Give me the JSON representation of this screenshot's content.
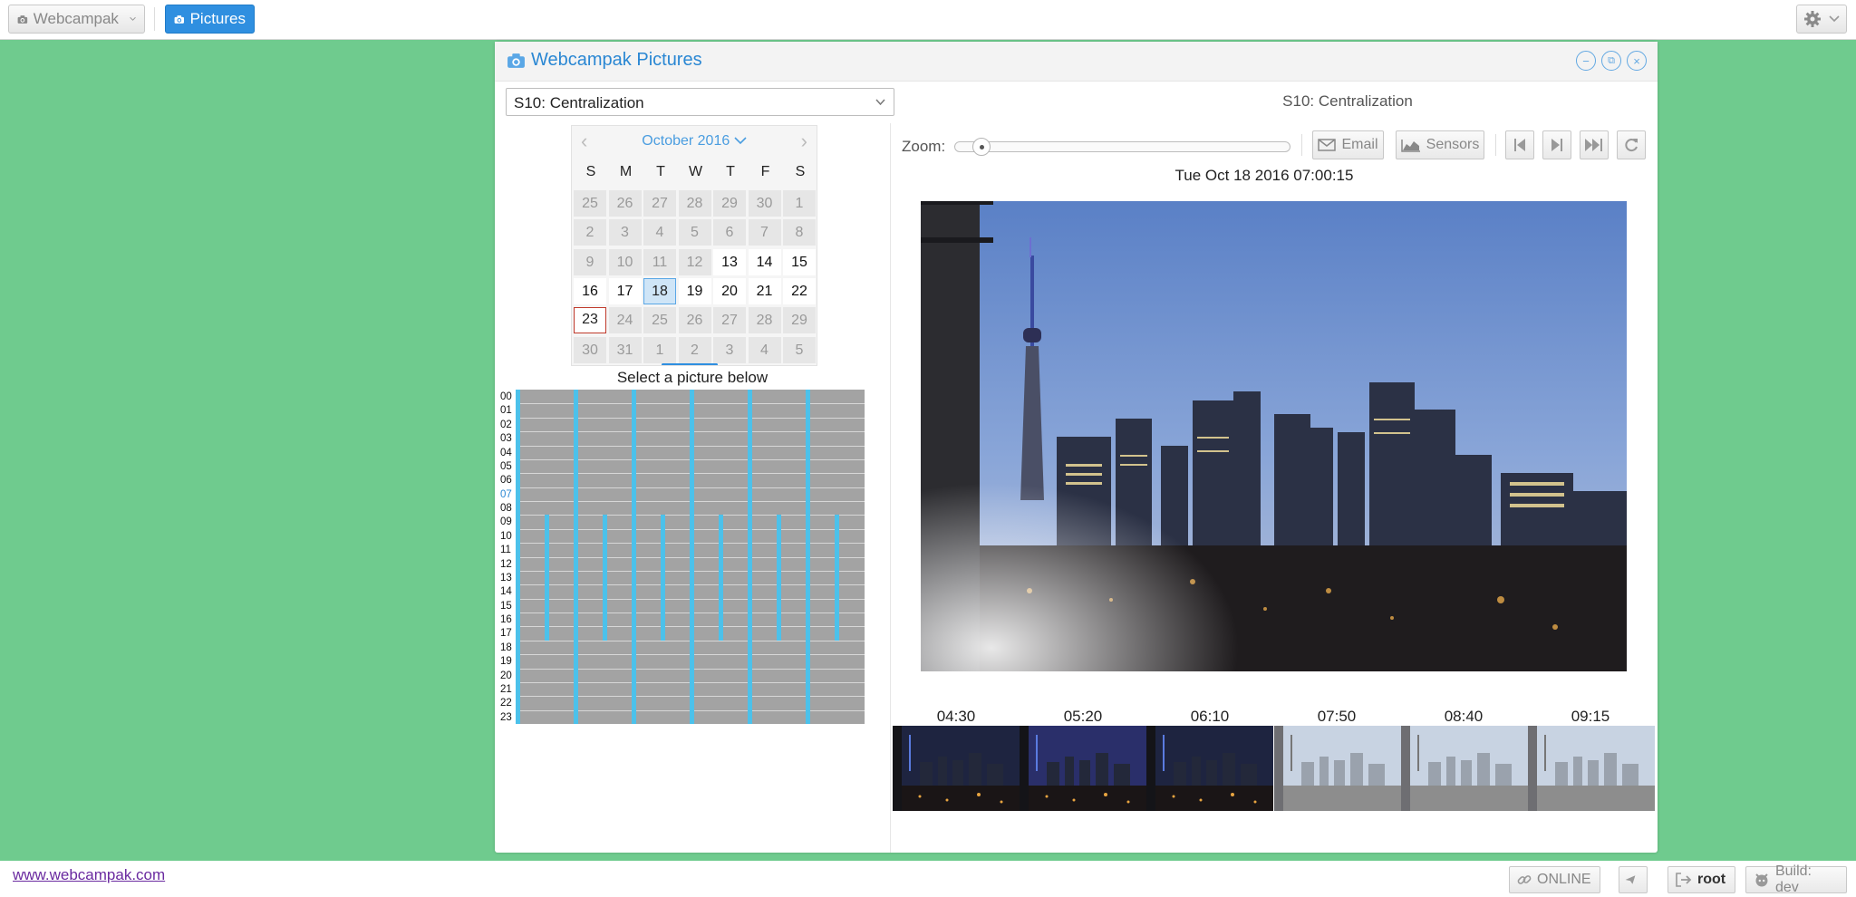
{
  "topbar": {
    "app_menu_label": "Webcampak",
    "pictures_label": "Pictures"
  },
  "window": {
    "title": "Webcampak Pictures",
    "source_select_value": "S10: Centralization",
    "source_title": "S10: Centralization"
  },
  "calendar": {
    "month_label": "October 2016",
    "prev": "‹",
    "next": "›",
    "weekdays": [
      "S",
      "M",
      "T",
      "W",
      "T",
      "F",
      "S"
    ],
    "weeks": [
      [
        "25",
        "26",
        "27",
        "28",
        "29",
        "30",
        "1"
      ],
      [
        "2",
        "3",
        "4",
        "5",
        "6",
        "7",
        "8"
      ],
      [
        "9",
        "10",
        "11",
        "12",
        "13",
        "14",
        "15"
      ],
      [
        "16",
        "17",
        "18",
        "19",
        "20",
        "21",
        "22"
      ],
      [
        "23",
        "24",
        "25",
        "26",
        "27",
        "28",
        "29"
      ],
      [
        "30",
        "31",
        "1",
        "2",
        "3",
        "4",
        "5"
      ]
    ],
    "selected_day": "18",
    "today": "23"
  },
  "picture_grid": {
    "label": "Select a picture below",
    "hours": [
      "00",
      "01",
      "02",
      "03",
      "04",
      "05",
      "06",
      "07",
      "08",
      "09",
      "10",
      "11",
      "12",
      "13",
      "14",
      "15",
      "16",
      "17",
      "18",
      "19",
      "20",
      "21",
      "22",
      "23"
    ],
    "highlighted_hour": "07"
  },
  "viewer": {
    "zoom_label": "Zoom:",
    "zoom_level": 0.05,
    "email_label": "Email",
    "sensors_label": "Sensors",
    "timestamp": "Tue Oct 18 2016 07:00:15",
    "thumb_times": [
      "04:30",
      "05:20",
      "06:10",
      "07:50",
      "08:40",
      "09:15"
    ]
  },
  "footer": {
    "site_link": "www.webcampak.com",
    "status": "ONLINE",
    "user": "root",
    "build": "Build: dev"
  },
  "colors": {
    "background": "#6fcb8e",
    "accent": "#2f8fe0",
    "grid_marker": "#4cc1ea",
    "today_border": "#c0392b"
  }
}
